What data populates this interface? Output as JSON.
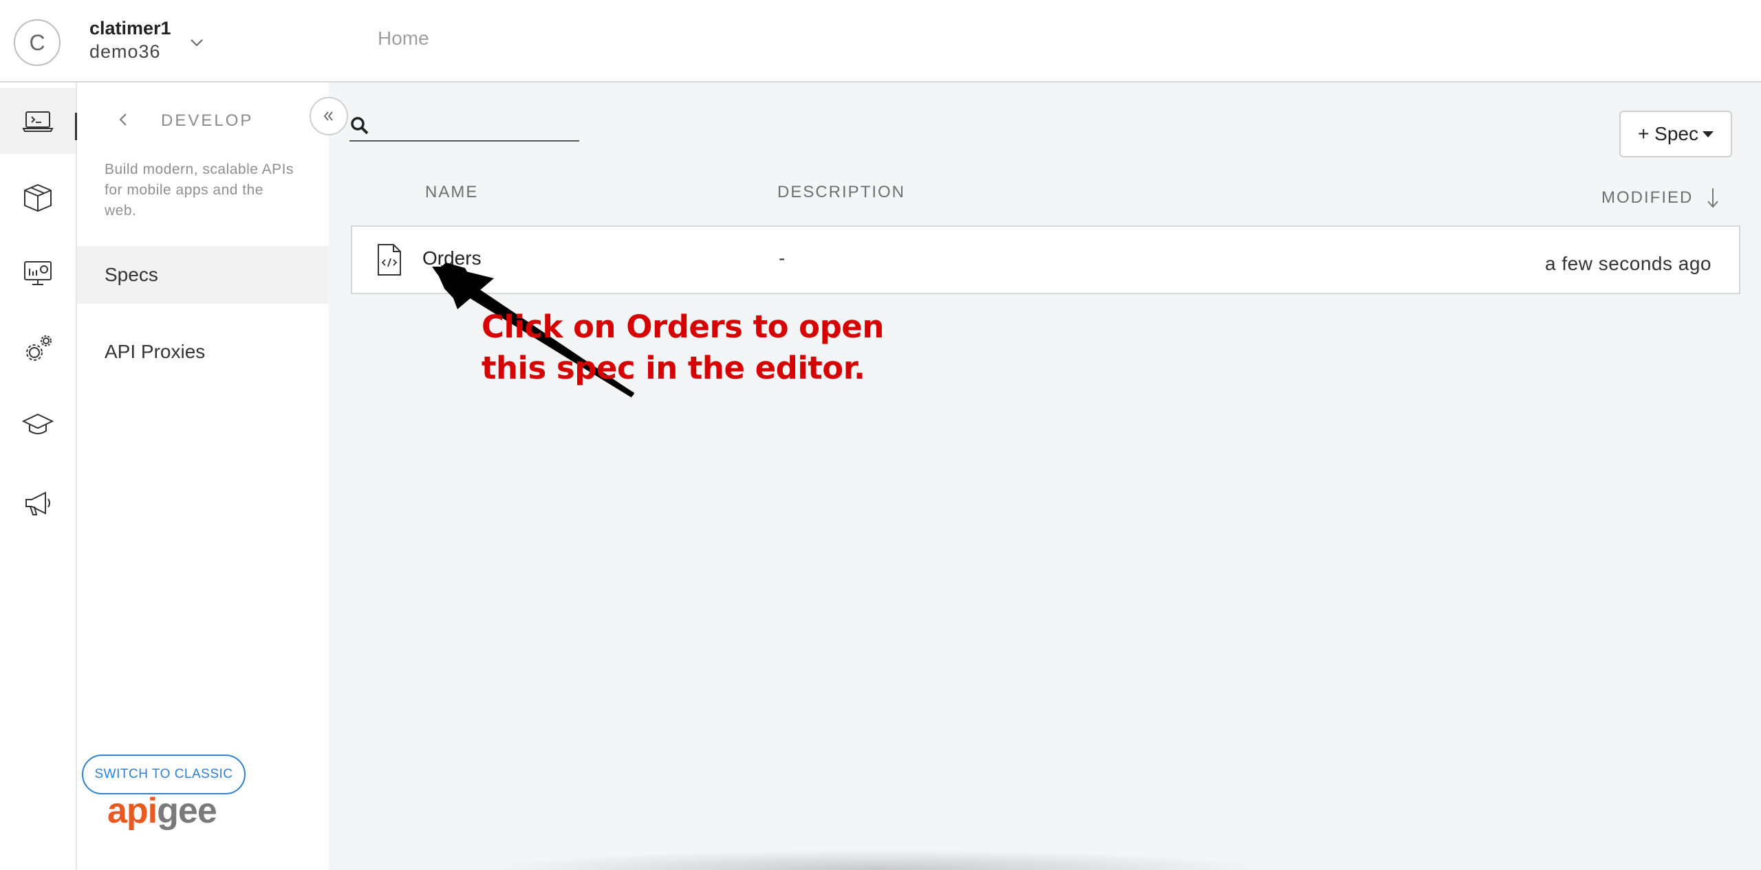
{
  "header": {
    "avatar_initial": "C",
    "user_name": "clatimer1",
    "org_name": "demo36",
    "home_label": "Home"
  },
  "rail": {
    "items": [
      {
        "icon": "develop-terminal-icon"
      },
      {
        "icon": "publish-package-icon"
      },
      {
        "icon": "analyze-monitor-icon"
      },
      {
        "icon": "admin-gears-icon"
      },
      {
        "icon": "learn-graduation-cap-icon"
      },
      {
        "icon": "announcements-megaphone-icon"
      }
    ]
  },
  "panel": {
    "title": "DEVELOP",
    "description": "Build modern, scalable APIs for mobile apps and the web.",
    "items": [
      {
        "label": "Specs",
        "active": true
      },
      {
        "label": "API Proxies",
        "active": false
      }
    ],
    "switch_label": "SWITCH TO CLASSIC",
    "logo_part1": "api",
    "logo_part2": "gee"
  },
  "main": {
    "search": {
      "placeholder": ""
    },
    "add_spec_label": "+ Spec",
    "columns": {
      "name": "NAME",
      "description": "DESCRIPTION",
      "modified": "MODIFIED"
    },
    "rows": [
      {
        "name": "Orders",
        "description": "-",
        "modified": "a few seconds ago"
      }
    ]
  },
  "annotation": {
    "line1": "Click on Orders to open",
    "line2": "this spec in the editor.",
    "color": "#d70000"
  },
  "colors": {
    "accent_blue": "#2f80d1",
    "logo_orange": "#ea5a20",
    "logo_gray": "#7a7a7a"
  }
}
